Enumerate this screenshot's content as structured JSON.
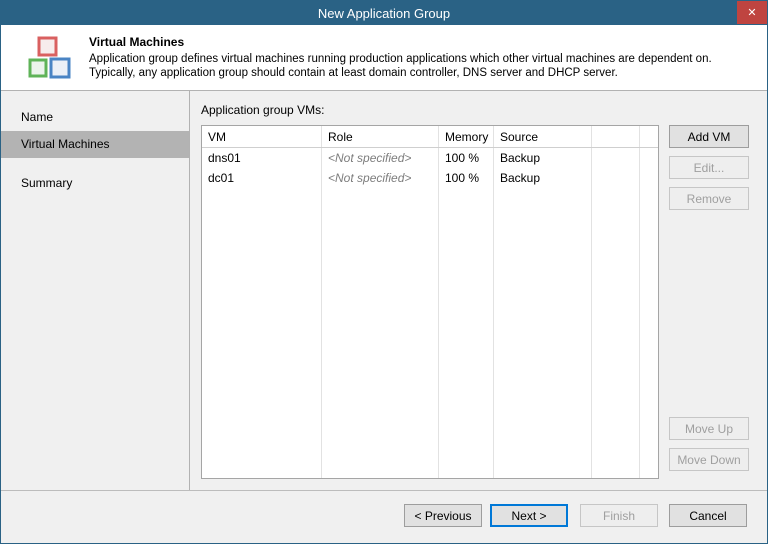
{
  "window": {
    "title": "New Application Group",
    "close_glyph": "✕"
  },
  "header": {
    "title": "Virtual Machines",
    "description_line1": "Application group defines virtual machines running production applications which other virtual machines are dependent on.",
    "description_line2": "Typically, any application group should contain at least domain controller, DNS server and DHCP server."
  },
  "sidebar": {
    "items": [
      {
        "label": "Name",
        "active": false
      },
      {
        "label": "Virtual Machines",
        "active": true
      },
      {
        "label": "Summary",
        "active": false
      }
    ]
  },
  "main": {
    "table_label": "Application group VMs:",
    "table": {
      "columns": [
        "VM",
        "Role",
        "Memory",
        "Source"
      ],
      "rows": [
        {
          "vm": "dns01",
          "role": "<Not specified>",
          "memory": "100 %",
          "source": "Backup"
        },
        {
          "vm": "dc01",
          "role": "<Not specified>",
          "memory": "100 %",
          "source": "Backup"
        }
      ]
    },
    "side_buttons": [
      {
        "label": "Add VM",
        "enabled": true
      },
      {
        "label": "Edit...",
        "enabled": false
      },
      {
        "label": "Remove",
        "enabled": false
      },
      {
        "label": "Move Up",
        "enabled": false
      },
      {
        "label": "Move Down",
        "enabled": false
      }
    ]
  },
  "footer": {
    "previous_label": "< Previous",
    "next_label": "Next >",
    "finish_label": "Finish",
    "cancel_label": "Cancel"
  },
  "colors": {
    "titlebar": "#2a6285",
    "close_button": "#bf4440",
    "accent_focus": "#0078d7",
    "selected_step_bg": "#b3b3b3"
  }
}
